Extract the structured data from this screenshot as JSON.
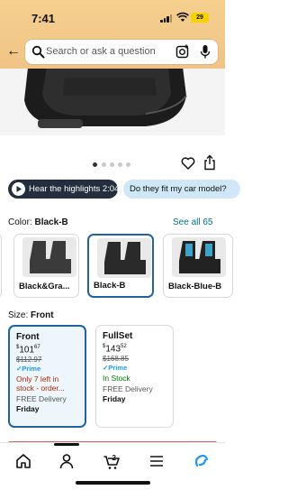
{
  "status_bar": {
    "time": "7:41",
    "battery": "29"
  },
  "search": {
    "placeholder": "Search or ask a question"
  },
  "carousel": {
    "dot_count": 5,
    "active_index": 0
  },
  "highlights_pill": {
    "label": "Hear the highlights 2:04"
  },
  "fit_pill": {
    "label": "Do they fit my car model?"
  },
  "color": {
    "label": "Color:",
    "selected": "Black-B",
    "see_all": "See all 65",
    "swatches": [
      {
        "label": "Black&Gra...",
        "color": "#3b3b3b"
      },
      {
        "label": "Black-B",
        "color": "#2a2a2a"
      },
      {
        "label": "Black-Blue-B",
        "color": "#3fa3c9"
      }
    ]
  },
  "size": {
    "label": "Size:",
    "selected": "Front",
    "options": [
      {
        "name": "Front",
        "price_whole": "101",
        "price_frac": "67",
        "list_price": "$112.97",
        "prime": "Prime",
        "stock": "Only 7 left in stock - order...",
        "stock_color": "#b12704",
        "delivery": "FREE Delivery",
        "day": "Friday"
      },
      {
        "name": "FullSet",
        "price_whole": "143",
        "price_frac": "52",
        "list_price": "$168.85",
        "prime": "Prime",
        "stock": "In Stock",
        "stock_color": "#007600",
        "delivery": "FREE Delivery",
        "day": "Friday"
      }
    ]
  },
  "tabbar": {
    "tabs": [
      "home-icon",
      "person-icon",
      "cart-icon",
      "menu-icon",
      "rufus-icon"
    ],
    "cart_count": "2"
  },
  "colors": {
    "accent": "#2162a1",
    "link": "#007185",
    "header": "#f2c98a"
  }
}
